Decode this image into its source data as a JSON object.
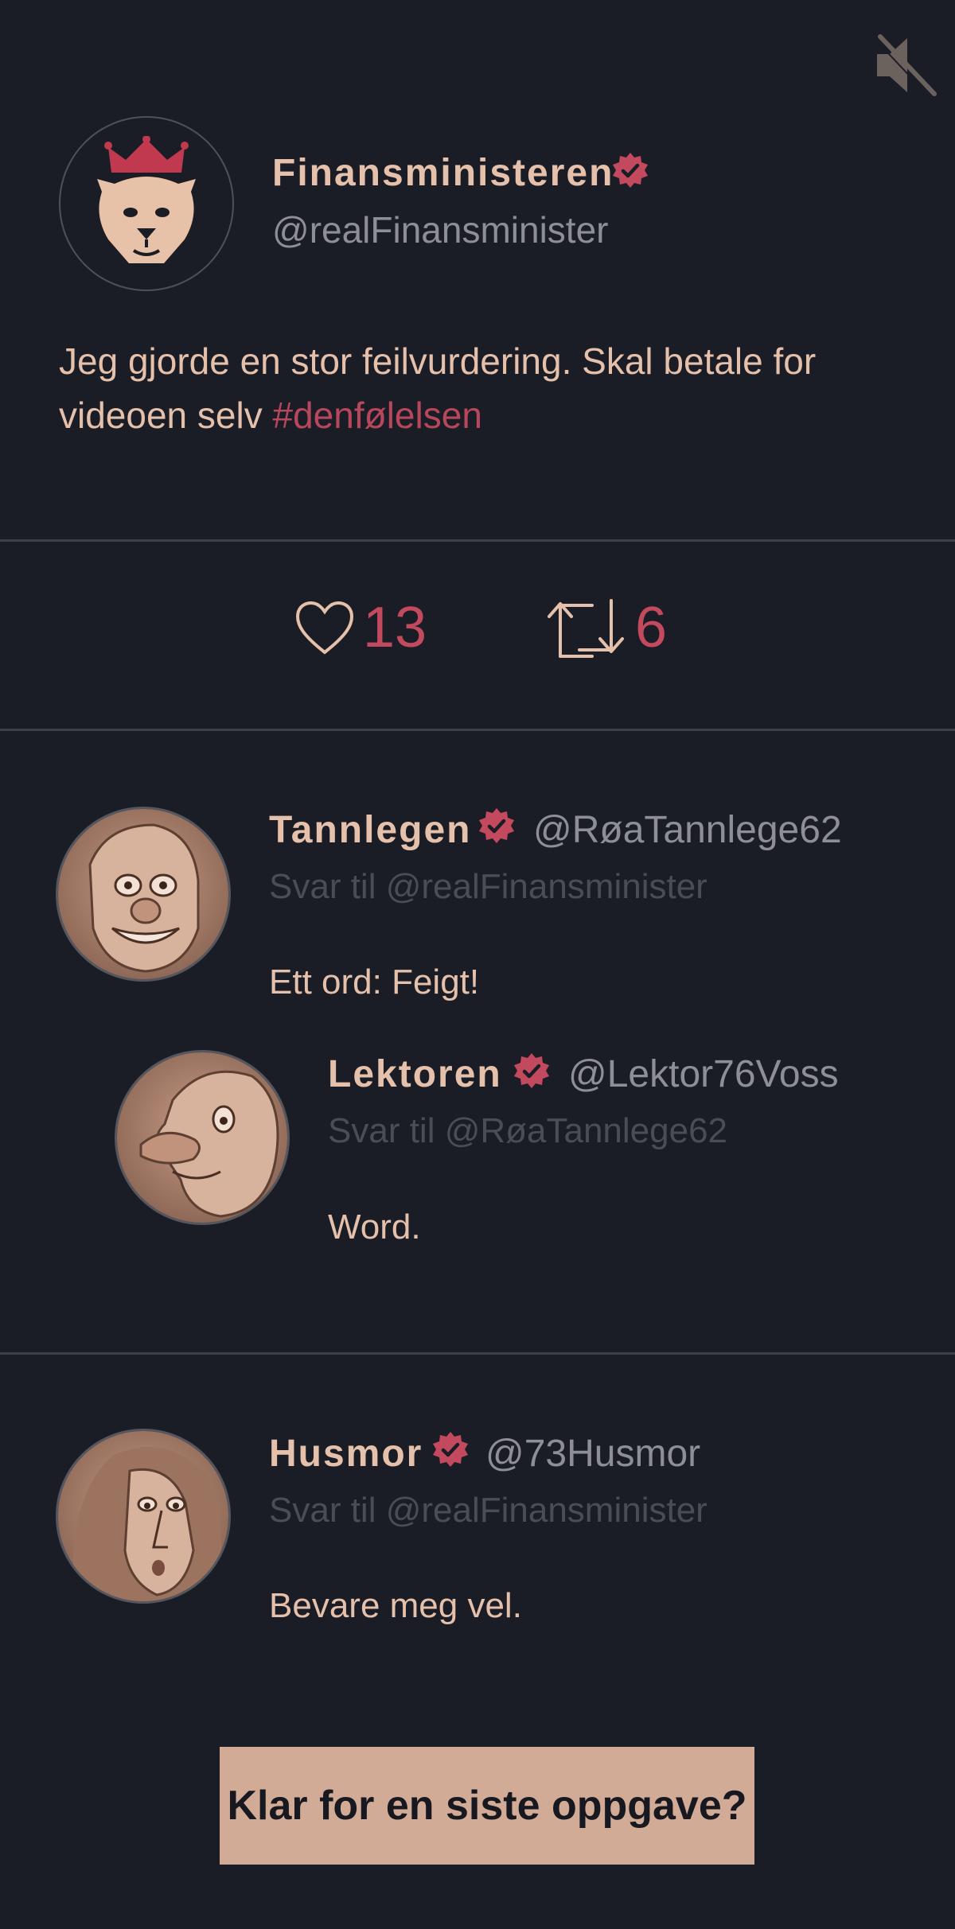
{
  "icons": {
    "mute": "speaker-muted-icon",
    "verified": "verified-badge-icon",
    "like": "heart-icon",
    "retweet": "retweet-icon"
  },
  "colors": {
    "background": "#1b1d26",
    "accent": "#c34a5e",
    "text": "#e5c0aa",
    "button_bg": "#d2ab97"
  },
  "post": {
    "name": "Finansministeren",
    "handle": "@realFinansminister",
    "text": "Jeg gjorde en stor feilvurdering. Skal betale for videoen selv ",
    "hashtag": "#denfølelsen",
    "likes": "13",
    "retweets": "6"
  },
  "comments": [
    {
      "name": "Tannlegen",
      "handle": "@RøaTannlege62",
      "reply_to": "Svar til @realFinansminister",
      "text": "Ett ord: Feigt!"
    },
    {
      "name": "Lektoren",
      "handle": "@Lektor76Voss",
      "reply_to": "Svar til @RøaTannlege62",
      "text": "Word."
    },
    {
      "name": "Husmor",
      "handle": "@73Husmor",
      "reply_to": "Svar til @realFinansminister",
      "text": "Bevare meg vel."
    }
  ],
  "cta": {
    "label": "Klar for en siste oppgave?"
  }
}
